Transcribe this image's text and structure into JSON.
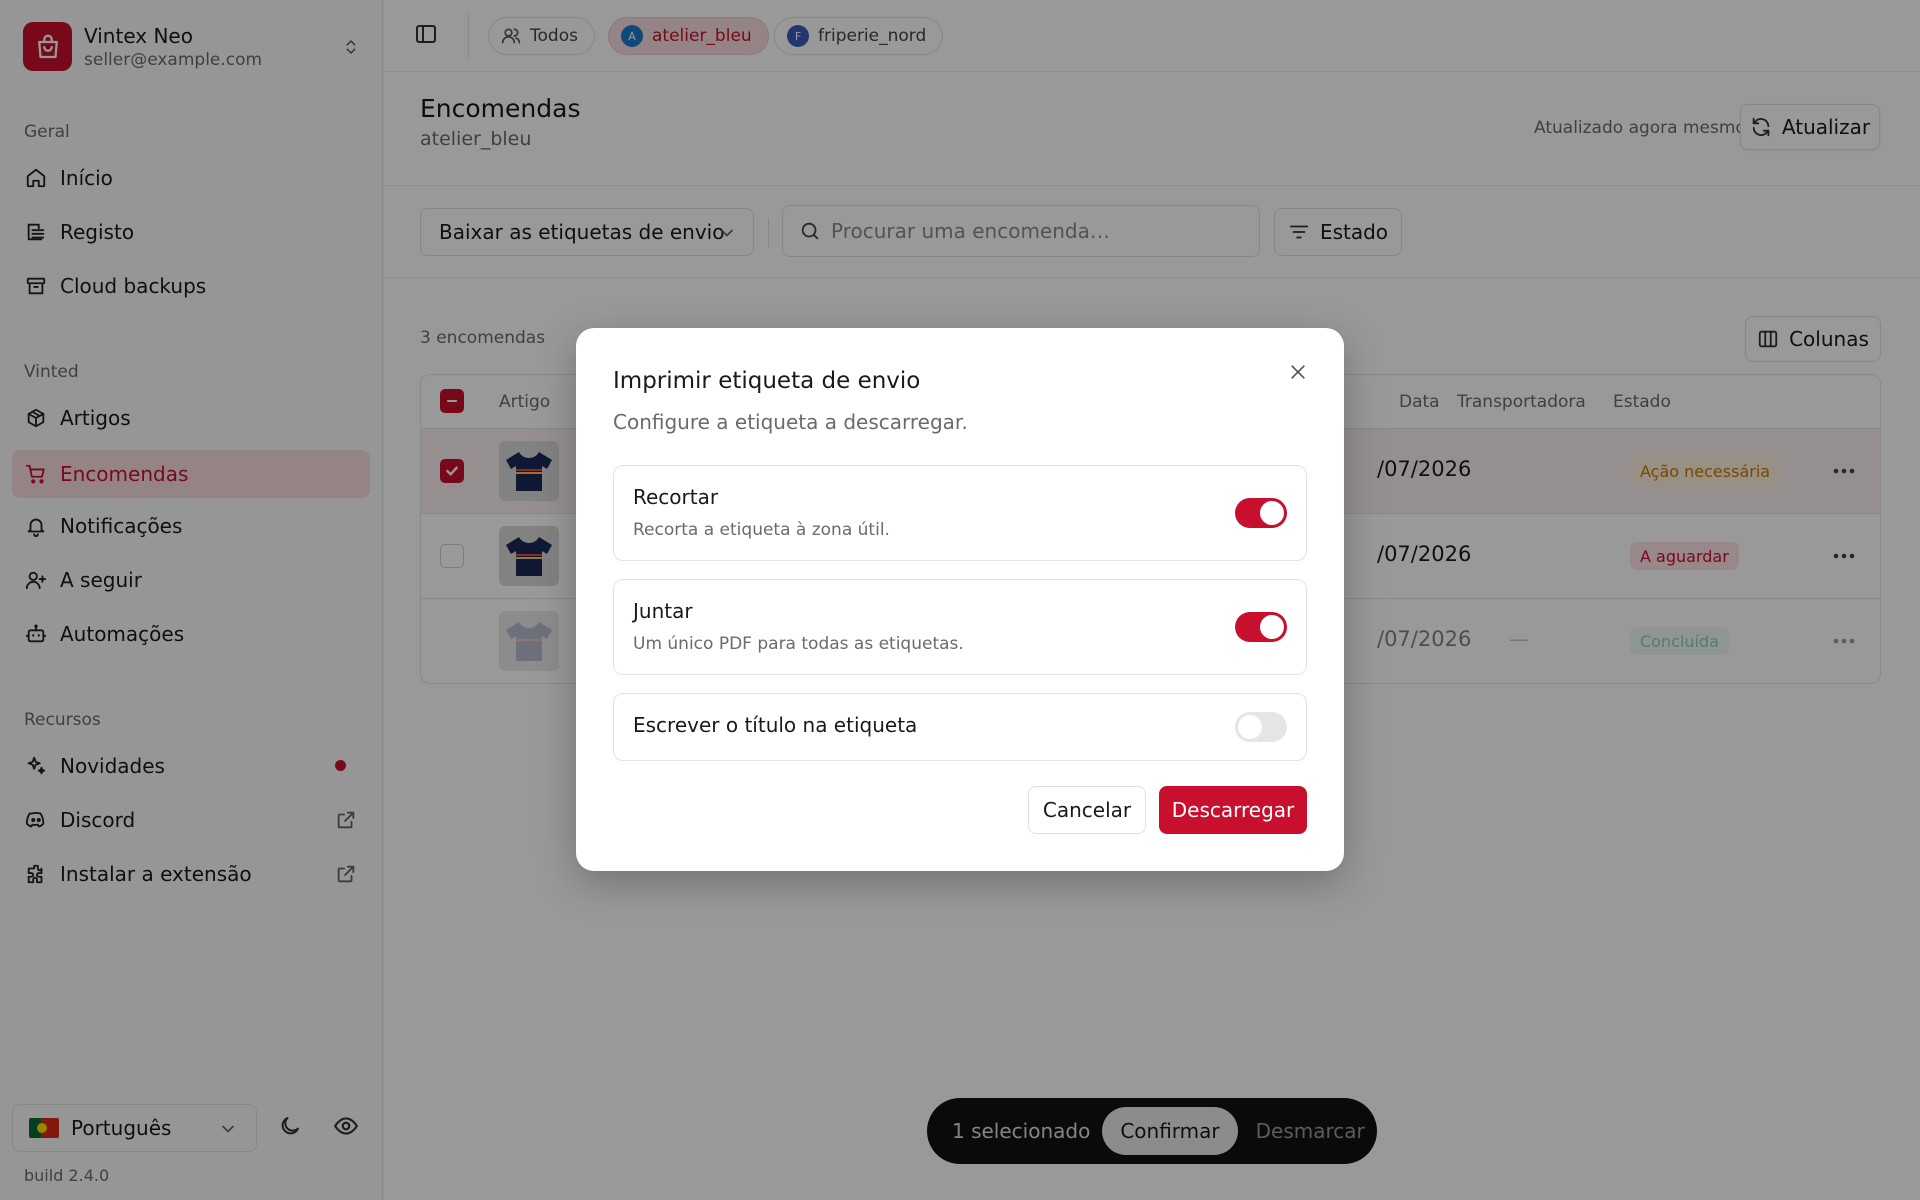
{
  "sidebar": {
    "brand_name": "Vintex Neo",
    "brand_email": "seller@example.com",
    "groups": {
      "geral": "Geral",
      "vinted": "Vinted",
      "recursos": "Recursos"
    },
    "items": {
      "inicio": "Início",
      "registo": "Registo",
      "cloud": "Cloud backups",
      "artigos": "Artigos",
      "encomendas": "Encomendas",
      "notificacoes": "Notificações",
      "seguir": "A seguir",
      "automacoes": "Automações",
      "novidades": "Novidades",
      "discord": "Discord",
      "extensao": "Instalar a extensão"
    },
    "language": "Português",
    "build": "build 2.4.0"
  },
  "topbar": {
    "chips": {
      "all": "Todos",
      "atelier": "atelier_bleu",
      "atelier_initial": "A",
      "friperie": "friperie_nord",
      "friperie_initial": "F"
    }
  },
  "page": {
    "title": "Encomendas",
    "subtitle": "atelier_bleu",
    "updated": "Atualizado agora mesmo",
    "refresh_label": "Atualizar"
  },
  "filters": {
    "action_select": "Baixar as etiquetas de envio",
    "search_placeholder": "Procurar uma encomenda…",
    "status_label": "Estado"
  },
  "table": {
    "count": "3 encomendas",
    "columns_label": "Colunas",
    "headers": {
      "artigo": "Artigo",
      "data": "Data",
      "transportadora": "Transportadora",
      "estado": "Estado"
    },
    "rows": [
      {
        "date": "/07/2026",
        "carrier": "",
        "status": "Ação necessária",
        "selected": true
      },
      {
        "date": "/07/2026",
        "carrier": "",
        "status": "A aguardar",
        "selected": false
      },
      {
        "date": "/07/2026",
        "carrier": "—",
        "status": "Concluída",
        "selected": false
      }
    ]
  },
  "actionbar": {
    "selected": "1 selecionado",
    "confirm": "Confirmar",
    "unmark": "Desmarcar"
  },
  "modal": {
    "title": "Imprimir etiqueta de envio",
    "description": "Configure a etiqueta a descarregar.",
    "options": [
      {
        "title": "Recortar",
        "desc": "Recorta a etiqueta à zona útil.",
        "enabled": true
      },
      {
        "title": "Juntar",
        "desc": "Um único PDF para todas as etiquetas.",
        "enabled": true
      },
      {
        "title": "Escrever o título na etiqueta",
        "desc": "",
        "enabled": false
      }
    ],
    "cancel": "Cancelar",
    "download": "Descarregar"
  },
  "colors": {
    "accent": "#c8102e",
    "warning": "#c47a00",
    "success": "#3aa86b"
  }
}
